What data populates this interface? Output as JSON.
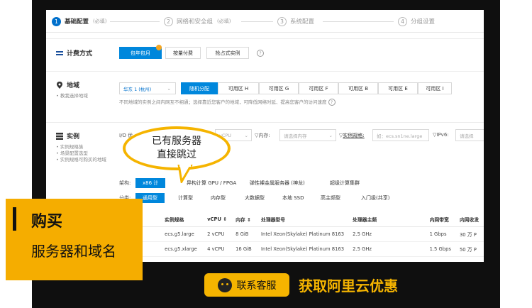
{
  "steps": [
    {
      "num": "1",
      "label": "基础配置",
      "sub": "(必填)"
    },
    {
      "num": "2",
      "label": "网络和安全组",
      "sub": "(必填)"
    },
    {
      "num": "3",
      "label": "系统配置",
      "sub": ""
    },
    {
      "num": "4",
      "label": "分组设置",
      "sub": ""
    }
  ],
  "billing": {
    "title": "计费方式",
    "options": [
      "包年包月",
      "按量付费",
      "抢占式实例"
    ]
  },
  "region": {
    "title": "地域",
    "bullet": "教我选择地域",
    "selected": "华东 1 (杭州)",
    "zones": [
      "随机分配",
      "可用区 H",
      "可用区 G",
      "可用区 F",
      "可用区 B",
      "可用区 E",
      "可用区 I"
    ],
    "hint": "不同地域的实例之间内网互不相通；选择靠近您客户的地域，可降低网络时延、提高您客户的访问速度"
  },
  "instance": {
    "title": "实例",
    "bullets": [
      "实例规格族",
      "场景配置选型",
      "实例规格可购买的地域"
    ],
    "io_label": "I/O 优",
    "vcpu_placeholder": "vCPU",
    "memory_label": "内存:",
    "memory_placeholder": "请选择内存",
    "spec_label": "实例规格:",
    "spec_placeholder": "如：ecs.sn1ne.large",
    "ipv6_label": "IPv6:",
    "ipv6_placeholder": "请选择",
    "arch_label": "架构:",
    "arch_tabs": [
      "x86 计",
      "异构计算 GPU / FPGA",
      "弹性裸金属服务器 (神龙)",
      "超级计算集群"
    ],
    "cat_label": "分类:",
    "cat_tabs": [
      "通用型",
      "计算型",
      "内存型",
      "大数据型",
      "本地 SSD",
      "高主频型",
      "入门级(共享)"
    ]
  },
  "table": {
    "headers": [
      "规格族",
      "实例规格",
      "vCPU",
      "内存",
      "处理器型号",
      "处理器主频",
      "内网带宽",
      "内网收发"
    ],
    "rows": [
      [
        "用型 g5",
        "ecs.g5.large",
        "2 vCPU",
        "8 GiB",
        "Intel Xeon(Skylake) Platinum 8163",
        "2.5 GHz",
        "1 Gbps",
        "30 万 P"
      ],
      [
        "用型 g5",
        "ecs.g5.xlarge",
        "4 vCPU",
        "16 GiB",
        "Intel Xeon(Skylake) Platinum 8163",
        "2.5 GHz",
        "1.5 Gbps",
        "50 万 P"
      ]
    ]
  },
  "bubble": {
    "line1": "已有服务器",
    "line2": "直接跳过"
  },
  "promo": {
    "title": "购买",
    "subtitle": "服务器和域名"
  },
  "cta": {
    "button": "联系客服",
    "right": "获取阿里云优惠"
  },
  "colors": {
    "accent": "#0087dc",
    "yellow": "#f5b400",
    "dark": "#0f0f0f"
  }
}
